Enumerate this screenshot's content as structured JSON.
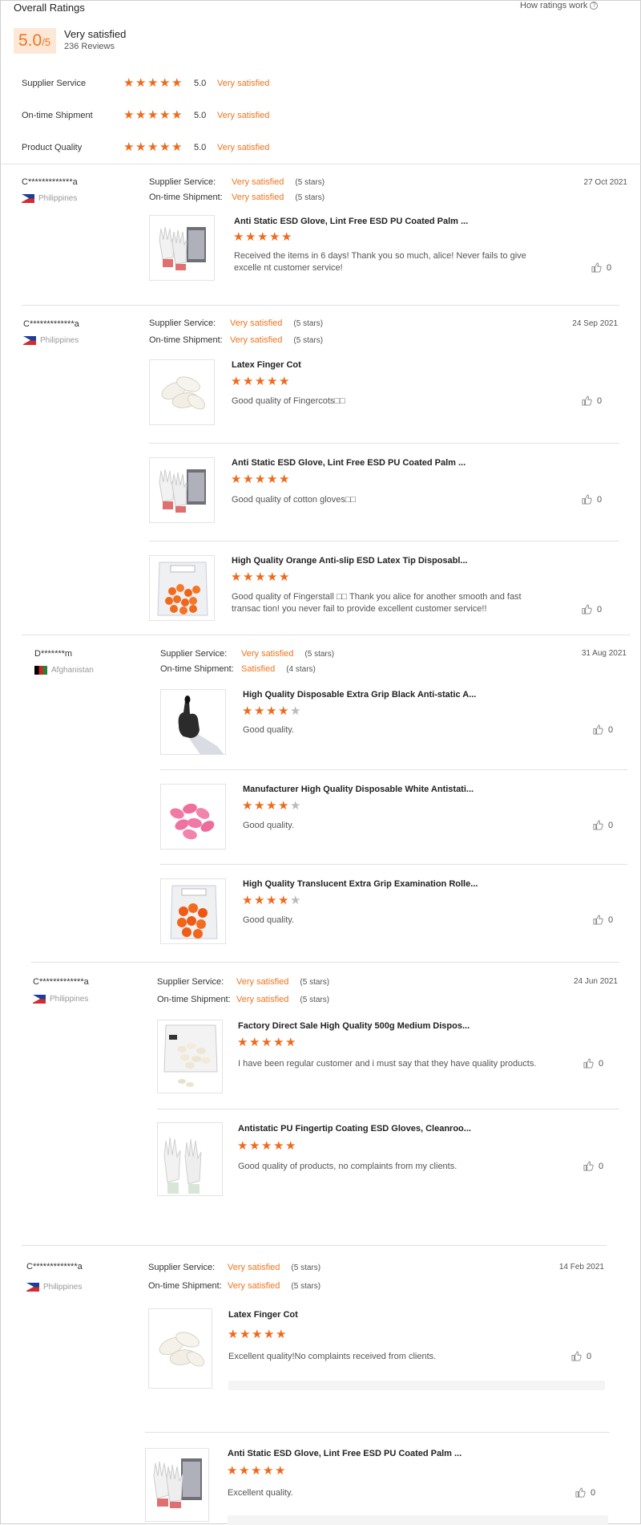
{
  "header": {
    "title": "Overall Ratings",
    "how_link": "How ratings work",
    "help_glyph": "?",
    "score": "5.0",
    "score_denom": "/5",
    "score_label": "Very satisfied",
    "review_count": "236 Reviews"
  },
  "categories": [
    {
      "name": "Supplier Service",
      "stars": 5,
      "value": "5.0",
      "word": "Very satisfied"
    },
    {
      "name": "On-time Shipment",
      "stars": 5,
      "value": "5.0",
      "word": "Very satisfied"
    },
    {
      "name": "Product Quality",
      "stars": 5,
      "value": "5.0",
      "word": "Very satisfied"
    }
  ],
  "labels": {
    "supplier_service": "Supplier Service:",
    "ontime_shipment": "On-time Shipment:"
  },
  "colors": {
    "accent": "#f0731e",
    "star": "#f06a1b",
    "star_off": "#bbbbbb"
  },
  "reviews": [
    {
      "name": "C*************a",
      "country": "Philippines",
      "flag": "philippines-flag",
      "supplier_word": "Very satisfied",
      "supplier_paren": "(5 stars)",
      "shipment_word": "Very satisfied",
      "shipment_paren": "(5 stars)",
      "date": "27 Oct 2021",
      "products": [
        {
          "title": "Anti Static ESD Glove, Lint Free ESD PU Coated Palm ...",
          "stars": 5,
          "text": "Received the items in 6 days! Thank you so much, alice! Never fails to give excelle nt customer service!",
          "likes": "0"
        }
      ]
    },
    {
      "name": "C*************a",
      "country": "Philippines",
      "flag": "philippines-flag",
      "supplier_word": "Very satisfied",
      "supplier_paren": "(5 stars)",
      "shipment_word": "Very satisfied",
      "shipment_paren": "(5 stars)",
      "date": "24 Sep 2021",
      "products": [
        {
          "title": "Latex Finger Cot",
          "stars": 5,
          "text": "Good quality of Fingercots□□",
          "likes": "0"
        },
        {
          "title": "Anti Static ESD Glove, Lint Free ESD PU Coated Palm ...",
          "stars": 5,
          "text": "Good quality of cotton gloves□□",
          "likes": "0"
        },
        {
          "title": "High Quality Orange Anti-slip ESD Latex Tip Disposabl...",
          "stars": 5,
          "text": "Good quality of Fingerstall □□ Thank you alice for another smooth and fast transac tion! you never fail to provide excellent customer service!!",
          "likes": "0"
        }
      ]
    },
    {
      "name": "D*******m",
      "country": "Afghanistan",
      "flag": "afghanistan-flag",
      "supplier_word": "Very satisfied",
      "supplier_paren": "(5 stars)",
      "shipment_word": "Satisfied",
      "shipment_paren": "(4 stars)",
      "date": "31 Aug 2021",
      "products": [
        {
          "title": "High Quality Disposable Extra Grip Black Anti-static A...",
          "stars": 4,
          "text": "Good quality.",
          "likes": "0"
        },
        {
          "title": "Manufacturer High Quality Disposable White Antistati...",
          "stars": 4,
          "text": "Good quality.",
          "likes": "0"
        },
        {
          "title": "High Quality Translucent Extra Grip Examination Rolle...",
          "stars": 4,
          "text": "Good quality.",
          "likes": "0"
        }
      ]
    },
    {
      "name": "C*************a",
      "country": "Philippines",
      "flag": "philippines-flag",
      "supplier_word": "Very satisfied",
      "supplier_paren": "(5 stars)",
      "shipment_word": "Very satisfied",
      "shipment_paren": "(5 stars)",
      "date": "24 Jun 2021",
      "products": [
        {
          "title": "Factory Direct Sale High Quality 500g Medium Dispos...",
          "stars": 5,
          "text": "I have been regular customer and i must say that they have quality products.",
          "likes": "0"
        },
        {
          "title": "Antistatic PU Fingertip Coating ESD Gloves, Cleanroo...",
          "stars": 5,
          "text": "Good quality of products, no complaints from my clients.",
          "likes": "0"
        }
      ]
    },
    {
      "name": "C*************a",
      "country": "Philippines",
      "flag": "philippines-flag",
      "supplier_word": "Very satisfied",
      "supplier_paren": "(5 stars)",
      "shipment_word": "Very satisfied",
      "shipment_paren": "(5 stars)",
      "date": "14 Feb 2021",
      "products": [
        {
          "title": "Latex Finger Cot",
          "stars": 5,
          "text": "Excellent quality!No complaints received from clients.",
          "likes": "0"
        },
        {
          "title": "Anti Static ESD Glove, Lint Free ESD PU Coated Palm ...",
          "stars": 5,
          "text": "Excellent quality.",
          "likes": "0"
        }
      ]
    }
  ]
}
